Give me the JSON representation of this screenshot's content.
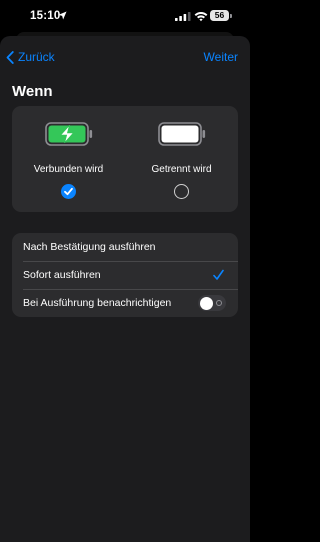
{
  "status_bar": {
    "time": "15:10",
    "battery_level": "56",
    "icons": [
      "location-arrow-icon",
      "cellular-signal-icon",
      "wifi-icon",
      "battery-icon"
    ]
  },
  "nav": {
    "back_label": "Zurück",
    "next_label": "Weiter"
  },
  "section": {
    "title": "Wenn"
  },
  "trigger_options": [
    {
      "label": "Verbunden wird",
      "icon": "battery-charging-icon",
      "selected": true
    },
    {
      "label": "Getrennt wird",
      "icon": "battery-full-icon",
      "selected": false
    }
  ],
  "run_options": {
    "items": [
      {
        "label": "Nach Bestätigung ausführen",
        "selected": false
      },
      {
        "label": "Sofort ausführen",
        "selected": true
      }
    ],
    "notify": {
      "label": "Bei Ausführung benachrichtigen",
      "enabled": false
    }
  },
  "colors": {
    "accent": "#0a84ff",
    "background": "#000000",
    "sheet": "#1c1c1e",
    "card": "#2c2c2e",
    "charging_green": "#34c759"
  }
}
